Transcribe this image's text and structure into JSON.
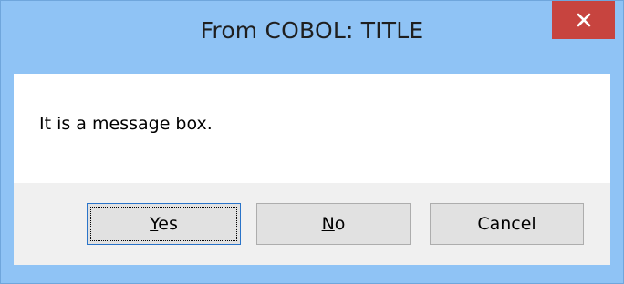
{
  "window": {
    "title": "From COBOL: TITLE"
  },
  "message": {
    "text": "It is a message box."
  },
  "buttons": {
    "yes": {
      "mnemonic": "Y",
      "rest": "es"
    },
    "no": {
      "mnemonic": "N",
      "rest": "o"
    },
    "cancel": {
      "label": "Cancel"
    }
  },
  "icons": {
    "close": "close-icon"
  },
  "colors": {
    "titlebar": "#8fc3f5",
    "close_button": "#c7443f",
    "button_bar": "#f0f0f0",
    "default_button_border": "#2a74c9"
  }
}
